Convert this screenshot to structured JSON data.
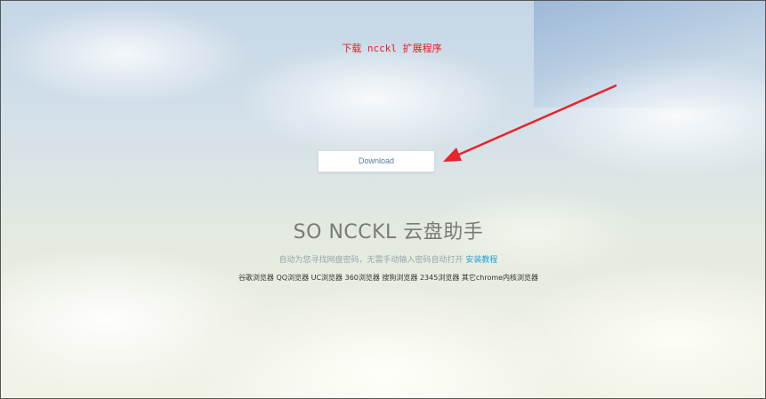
{
  "extension_link": "下载 ncckl 扩展程序",
  "download_button": "Download",
  "title": "SO NCCKL 云盘助手",
  "subtitle": {
    "text": "自动为您寻找网盘密码，无需手动输入密码自动打开 ",
    "link": "安装教程"
  },
  "browsers": "谷歌浏览器 QQ浏览器 UC浏览器 360浏览器 搜狗浏览器 2345浏览器 其它chrome内核浏览器",
  "colors": {
    "link_red": "#e02020",
    "link_blue": "#2a9fd6",
    "arrow_red": "#e8232b"
  }
}
